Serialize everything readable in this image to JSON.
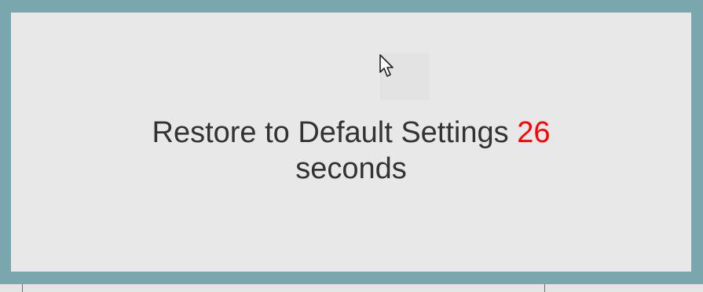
{
  "dialog": {
    "message": "Restore to Default Settings",
    "countdown_value": "26",
    "countdown_unit": "seconds"
  },
  "colors": {
    "frame": "#7aa6ae",
    "dialog_bg": "#e8e8e8",
    "text": "#333333",
    "countdown": "#ff0000"
  },
  "icons": {
    "cursor": "mouse-pointer-icon"
  }
}
